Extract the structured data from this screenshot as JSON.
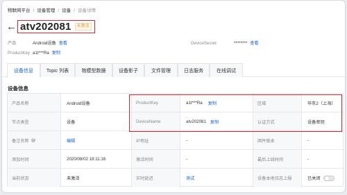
{
  "breadcrumb": {
    "items": [
      "物联网平台",
      "设备管理",
      "设备"
    ],
    "current": "设备详情"
  },
  "header": {
    "device_name": "atv202081",
    "status": "未激活"
  },
  "meta": {
    "product_label": "产品",
    "product_value": "Android设备",
    "product_link": "查看",
    "secret_label": "DeviceSecret",
    "secret_value": "********",
    "secret_link": "查看",
    "pk_label": "ProductKey",
    "pk_value": "a1t***Ra",
    "pk_link": "复制"
  },
  "tabs": [
    "设备信息",
    "Topic 列表",
    "物模型数据",
    "设备影子",
    "文件管理",
    "日志服务",
    "在线调试"
  ],
  "section_title": "设备信息",
  "info": {
    "rows": [
      [
        {
          "label": "产品名称",
          "value": "Android设备"
        },
        {
          "label": "ProductKey",
          "value": "a1t***Ra",
          "link": "复制"
        },
        {
          "label": "区域",
          "value": "华东2（上海）"
        }
      ],
      [
        {
          "label": "节点类型",
          "value": "设备"
        },
        {
          "label": "DeviceName",
          "value": "atv202081",
          "link": "复制"
        },
        {
          "label": "认证方式",
          "value": "设备密钥"
        }
      ],
      [
        {
          "label": "备注名称",
          "link": "编辑"
        },
        {
          "label": "IP地址",
          "value": "-"
        },
        {
          "label": "固件版本",
          "value": "-"
        }
      ],
      [
        {
          "label": "添加时间",
          "value": "2020/08/02 18:11:16"
        },
        {
          "label": "激活时间",
          "value": "-"
        },
        {
          "label": "最后上线时间",
          "value": "-"
        }
      ],
      [
        {
          "label": "当前状态",
          "value": "未激活"
        },
        {
          "label": "实时延迟",
          "link": "测试"
        },
        {
          "label": "设备本地日志上报",
          "value": "已关闭"
        }
      ]
    ]
  },
  "colors": {
    "accent": "#1a66d6",
    "highlight": "#d9252b",
    "status_warning": "#e6a23c"
  },
  "icons": {
    "back": "arrow-left-icon",
    "help": "help-circle-icon"
  }
}
